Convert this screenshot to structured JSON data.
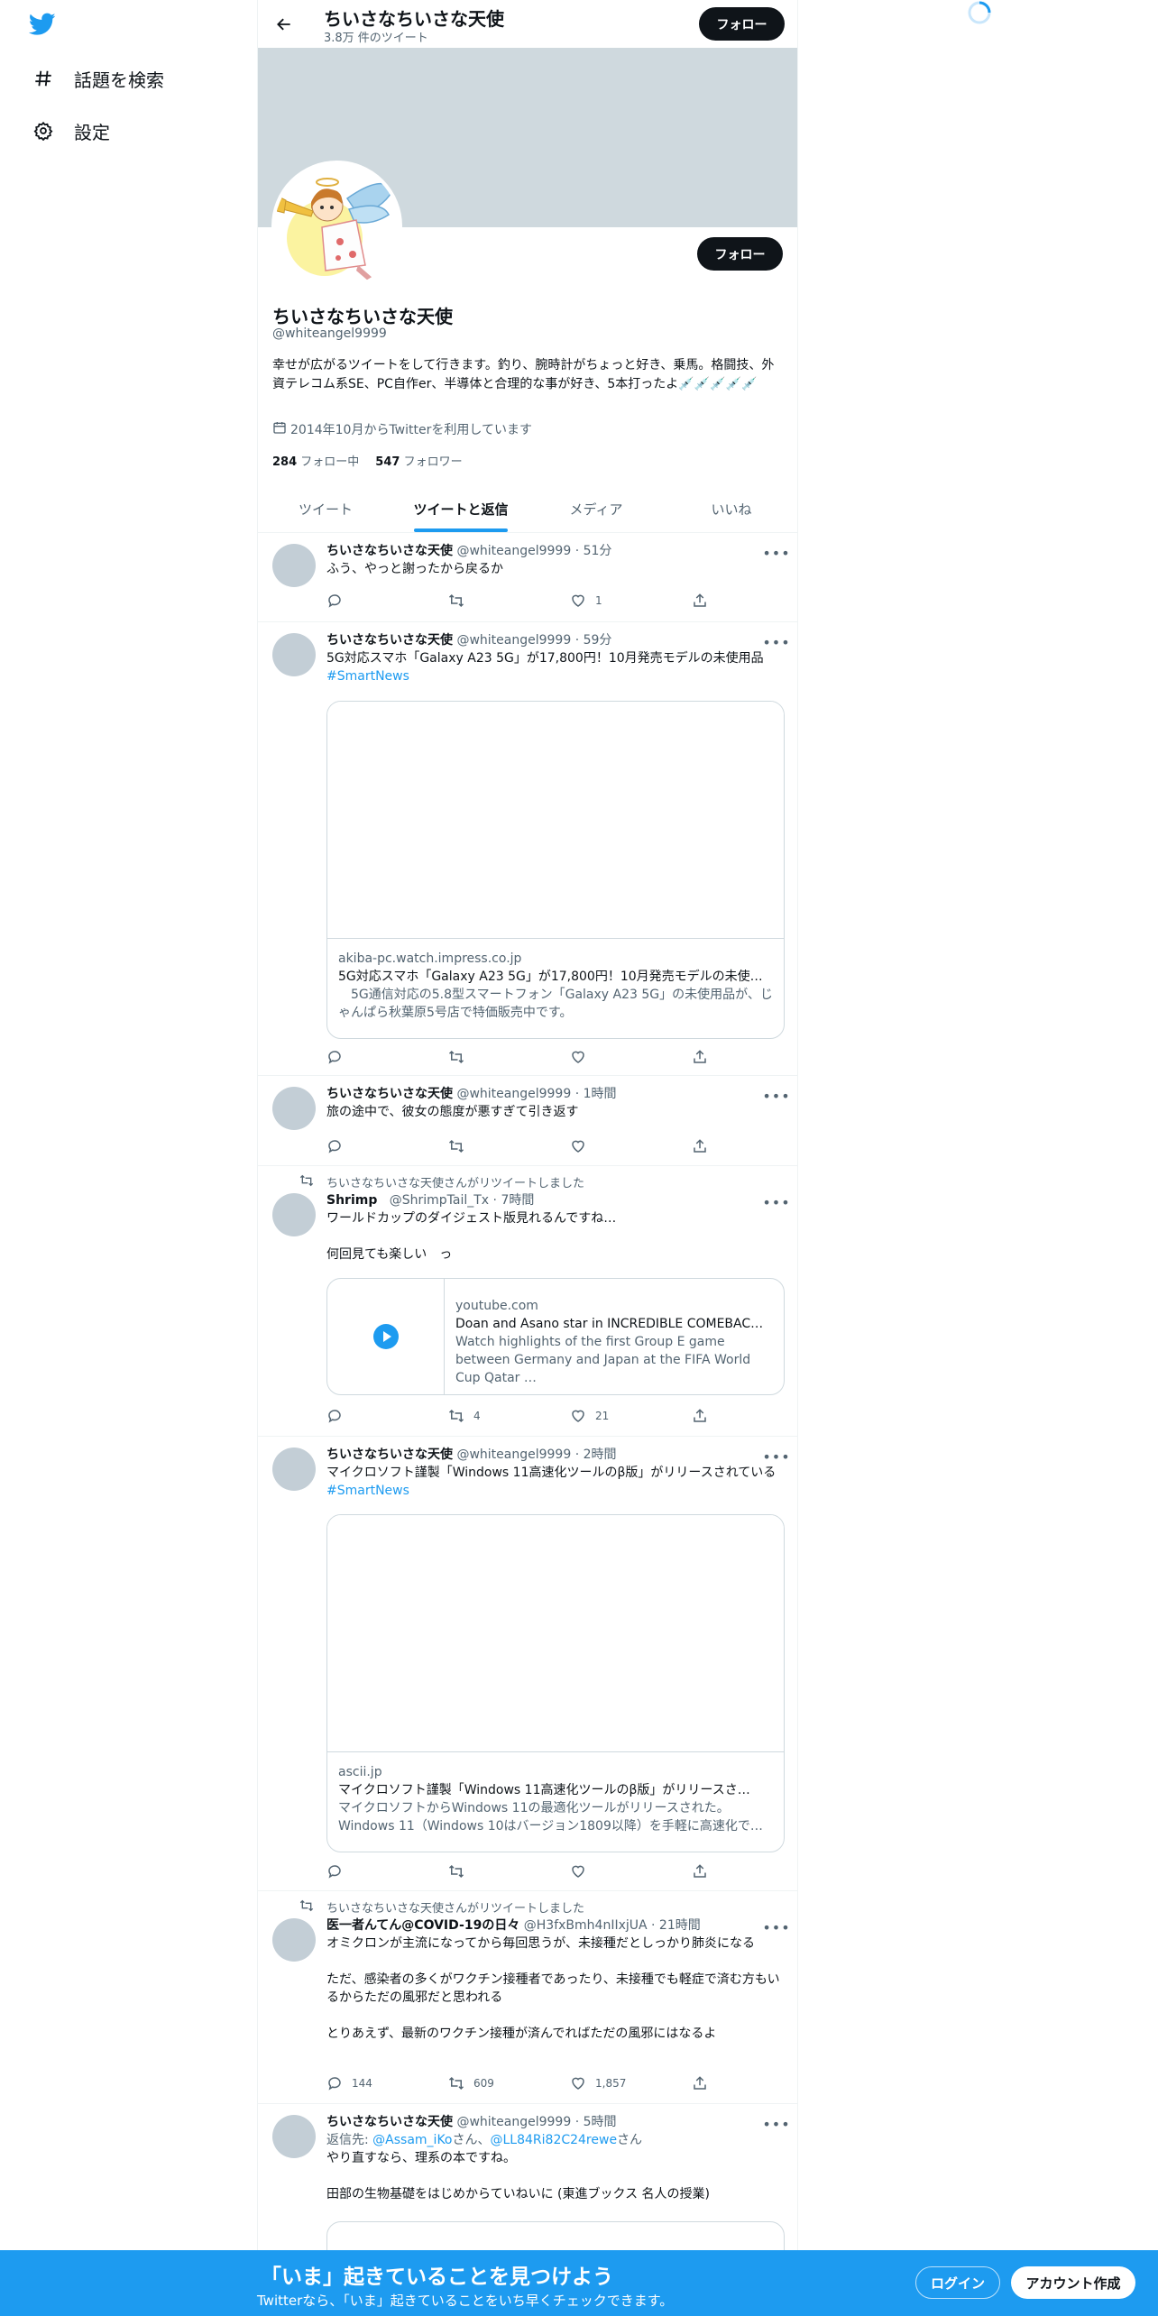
{
  "nav": {
    "items": [
      {
        "label": "話題を検索",
        "icon": "hashtag-icon"
      },
      {
        "label": "設定",
        "icon": "gear-icon"
      }
    ]
  },
  "header": {
    "name": "ちいさなちいさな天使",
    "tweet_count": "3.8万 件のツイート",
    "follow_label": "フォロー"
  },
  "profile": {
    "name": "ちいさなちいさな天使",
    "handle": "@whiteangel9999",
    "bio": "幸せが広がるツイートをして行きます。釣り、腕時計がちょっと好き、乗馬。格闘技、外資テレコム系SE、PC自作er、半導体と合理的な事が好き、5本打ったよ💉💉💉💉💉",
    "joined": "2014年10月からTwitterを利用しています",
    "following_count": "284",
    "following_label": "フォロー中",
    "followers_count": "547",
    "followers_label": "フォロワー",
    "follow_label": "フォロー"
  },
  "tabs": [
    {
      "label": "ツイート"
    },
    {
      "label": "ツイートと返信"
    },
    {
      "label": "メディア"
    },
    {
      "label": "いいね"
    }
  ],
  "tweets": [
    {
      "name": "ちいさなちいさな天使",
      "meta": "@whiteangel9999 · 51分",
      "text": "ふう、やっと謝ったから戻るか",
      "replies": "",
      "retweets": "",
      "likes": "1"
    },
    {
      "name": "ちいさなちいさな天使",
      "meta": "@whiteangel9999 · 59分",
      "text": "5G対応スマホ「Galaxy A23 5G」が17,800円！10月発売モデルの未使用品",
      "hashtag": "#SmartNews",
      "card": {
        "domain": "akiba-pc.watch.impress.co.jp",
        "title": "5G対応スマホ「Galaxy A23 5G」が17,800円！10月発売モデルの未使…",
        "desc": "　5G通信対応の5.8型スマートフォン「Galaxy A23 5G」の未使用品が、じゃんぱら秋葉原5号店で特価販売中です。"
      },
      "replies": "",
      "retweets": "",
      "likes": ""
    },
    {
      "name": "ちいさなちいさな天使",
      "meta": "@whiteangel9999 · 1時間",
      "text": "旅の途中で、彼女の態度が悪すぎて引き返す",
      "replies": "",
      "retweets": "",
      "likes": ""
    },
    {
      "retweet_by": "ちいさなちいさな天使さんがリツイートしました",
      "name": "Shrimp",
      "meta": "@ShrimpTail_Tx · 7時間",
      "text": "ワールドカップのダイジェスト版見れるんですね…\n\n何回見ても楽しい　っ",
      "card": {
        "domain": "youtube.com",
        "title": "Doan and Asano star in INCREDIBLE COMEBAC…",
        "desc": "Watch highlights of the first Group E game between Germany and Japan at the FIFA World Cup Qatar …"
      },
      "replies": "",
      "retweets": "4",
      "likes": "21"
    },
    {
      "name": "ちいさなちいさな天使",
      "meta": "@whiteangel9999 · 2時間",
      "text": "マイクロソフト謹製「Windows 11高速化ツールのβ版」がリリースされている",
      "hashtag": "#SmartNews",
      "card": {
        "domain": "ascii.jp",
        "title": "マイクロソフト謹製「Windows 11高速化ツールのβ版」がリリースさ…",
        "desc": "マイクロソフトからWindows 11の最適化ツールがリリースされた。Windows 11（Windows 10はバージョン1809以降）を手軽に高速化で…"
      },
      "replies": "",
      "retweets": "",
      "likes": ""
    },
    {
      "retweet_by": "ちいさなちいさな天使さんがリツイートしました",
      "name": "医一者んてん@COVID-19の日々",
      "meta": "@H3fxBmh4nIIxjUA · 21時間",
      "text": "オミクロンが主流になってから毎回思うが、未接種だとしっかり肺炎になる\n\nただ、感染者の多くがワクチン接種者であったり、未接種でも軽症で済む方もいるからただの風邪だと思われる\n\nとりあえず、最新のワクチン接種が済んでればただの風邪にはなるよ",
      "replies": "144",
      "retweets": "609",
      "likes": "1,857"
    },
    {
      "name": "ちいさなちいさな天使",
      "meta": "@whiteangel9999 · 5時間",
      "reply_prefix": "返信先: ",
      "reply_to_1": "@Assam_iKo",
      "reply_san_1": "さん、",
      "reply_to_2": "@LL84Ri82C24rewe",
      "reply_san_2": "さん",
      "text": "やり直すなら、理系の本ですね。\n\n田部の生物基礎をはじめからていねいに (東進ブックス 名人の授業)"
    }
  ],
  "bottom": {
    "title": "「いま」起きていることを見つけよう",
    "subtitle": "Twitterなら、「いま」起きていることをいち早くチェックできます。",
    "login_label": "ログイン",
    "signup_label": "アカウント作成"
  },
  "colors": {
    "accent": "#1d9bf0",
    "banner": "#cfd9de",
    "button_dark": "#0f1419"
  }
}
